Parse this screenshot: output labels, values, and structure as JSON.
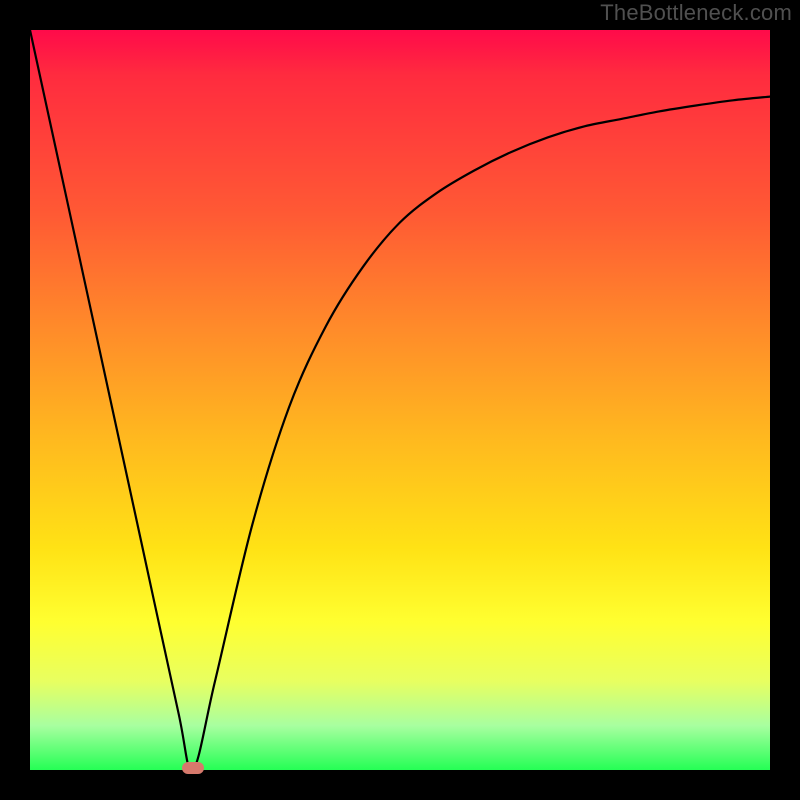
{
  "watermark": "TheBottleneck.com",
  "colors": {
    "frame_bg": "#000000",
    "gradient_top": "#ff0a4a",
    "gradient_mid1": "#ff8a2a",
    "gradient_mid2": "#ffe215",
    "gradient_bottom": "#25ff55",
    "curve": "#000000",
    "marker": "#d6796c"
  },
  "chart_data": {
    "type": "line",
    "title": "",
    "xlabel": "",
    "ylabel": "",
    "xlim": [
      0,
      100
    ],
    "ylim": [
      0,
      100
    ],
    "x": [
      0,
      5,
      10,
      15,
      20,
      22,
      25,
      30,
      35,
      40,
      45,
      50,
      55,
      60,
      65,
      70,
      75,
      80,
      85,
      90,
      95,
      100
    ],
    "values": [
      100,
      77,
      54,
      31,
      8,
      0,
      12,
      33,
      49,
      60,
      68,
      74,
      78,
      81,
      83.5,
      85.5,
      87,
      88,
      89,
      89.8,
      90.5,
      91
    ],
    "annotations": [
      {
        "type": "marker",
        "x": 22,
        "y": 0,
        "label": ""
      }
    ],
    "grid": false,
    "legend": false,
    "background_gradient": {
      "direction": "vertical",
      "stops": [
        {
          "pos": 0.0,
          "color": "#ff0a4a"
        },
        {
          "pos": 0.25,
          "color": "#ff5a34"
        },
        {
          "pos": 0.55,
          "color": "#ffb81f"
        },
        {
          "pos": 0.8,
          "color": "#ffff30"
        },
        {
          "pos": 1.0,
          "color": "#25ff55"
        }
      ]
    }
  }
}
